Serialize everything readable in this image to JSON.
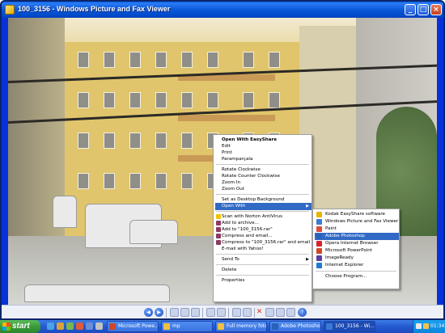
{
  "window": {
    "title": "100_3156 - Windows Picture and Fax Viewer",
    "controls": {
      "minimize": "_",
      "maximize": "□",
      "close": "×"
    }
  },
  "context_menu": {
    "items": [
      {
        "label": "Open With EasyShare",
        "bold": true
      },
      {
        "label": "Edit"
      },
      {
        "label": "Print"
      },
      {
        "label": "Paramparçala"
      },
      {
        "separator": true
      },
      {
        "label": "Rotate Clockwise"
      },
      {
        "label": "Rotate Counter Clockwise"
      },
      {
        "label": "Zoom In"
      },
      {
        "label": "Zoom Out"
      },
      {
        "separator": true
      },
      {
        "label": "Set as Desktop Background"
      },
      {
        "label": "Open With",
        "submenu": true,
        "highlighted": true
      },
      {
        "separator": true
      },
      {
        "label": "Scan with Norton AntiVirus"
      },
      {
        "label": "Add to archive..."
      },
      {
        "label": "Add to \"100_3156.rar\""
      },
      {
        "label": "Compress and email..."
      },
      {
        "label": "Compress to \"100_3156.rar\" and email"
      },
      {
        "label": "E-mail with Yahoo!"
      },
      {
        "separator": true
      },
      {
        "label": "Send To",
        "submenu": true
      },
      {
        "separator": true
      },
      {
        "label": "Delete"
      },
      {
        "separator": true
      },
      {
        "label": "Properties"
      }
    ]
  },
  "open_with_submenu": {
    "items": [
      {
        "label": "Kodak EasyShare software",
        "icon": "kodak-icon",
        "color": "#e8b400"
      },
      {
        "label": "Windows Picture and Fax Viewer",
        "icon": "picture-viewer-icon",
        "color": "#3a7bd5"
      },
      {
        "label": "Paint",
        "icon": "paint-icon",
        "color": "#d94c3a"
      },
      {
        "label": "Adobe Photoshop",
        "icon": "photoshop-icon",
        "color": "#2a62b8",
        "highlighted": true
      },
      {
        "label": "Opera Internet Browser",
        "icon": "opera-icon",
        "color": "#d8232a"
      },
      {
        "label": "Microsoft PowerPoint",
        "icon": "powerpoint-icon",
        "color": "#d24726"
      },
      {
        "label": "ImageReady",
        "icon": "imageready-icon",
        "color": "#5a3fa0"
      },
      {
        "label": "Internet Explorer",
        "icon": "ie-icon",
        "color": "#1e7ad0"
      },
      {
        "separator": true
      },
      {
        "label": "Choose Program..."
      }
    ]
  },
  "taskbar": {
    "start_label": "start",
    "buttons": [
      {
        "label": "Microsoft Powe...",
        "icon": "powerpoint-icon",
        "color": "#d24726"
      },
      {
        "label": "mp",
        "icon": "folder-icon",
        "color": "#f0c040"
      },
      {
        "label": "Full memory foto",
        "icon": "folder-icon",
        "color": "#f0c040"
      },
      {
        "label": "Adobe Photoshop",
        "icon": "photoshop-icon",
        "color": "#2a62b8"
      },
      {
        "label": "100_3156 - Wi...",
        "icon": "picture-viewer-icon",
        "color": "#3a7bd5",
        "active": true
      }
    ],
    "clock": "01:34"
  }
}
